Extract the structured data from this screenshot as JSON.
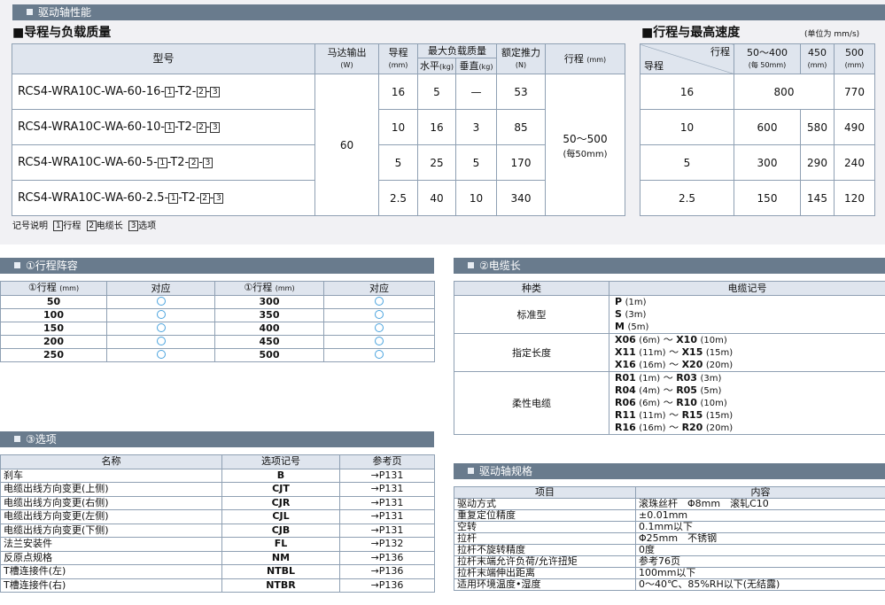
{
  "section_main": {
    "title": "驱动轴性能"
  },
  "lead_load": {
    "heading": "■导程与负载质量",
    "headers": {
      "model": "型号",
      "motor": "马达输出",
      "motor_unit": "(W)",
      "lead": "导程",
      "lead_unit": "(mm)",
      "max_load": "最大负载质量",
      "horizontal": "水平",
      "vertical": "垂直",
      "kg": "(kg)",
      "thrust": "额定推力",
      "thrust_unit": "(N)",
      "stroke": "行程",
      "stroke_unit": "(mm)"
    },
    "motor_value": "60",
    "stroke_value": "50～500",
    "stroke_note": "(每50mm)",
    "rows": [
      {
        "prefix": "RCS4-WRA10C-WA-60-16-",
        "lead": "16",
        "horizontal": "5",
        "vertical": "—",
        "thrust": "53"
      },
      {
        "prefix": "RCS4-WRA10C-WA-60-10-",
        "lead": "10",
        "horizontal": "16",
        "vertical": "3",
        "thrust": "85"
      },
      {
        "prefix": "RCS4-WRA10C-WA-60-5-",
        "lead": "5",
        "horizontal": "25",
        "vertical": "5",
        "thrust": "170"
      },
      {
        "prefix": "RCS4-WRA10C-WA-60-2.5-",
        "lead": "2.5",
        "horizontal": "40",
        "vertical": "10",
        "thrust": "340"
      }
    ],
    "code_boxes": {
      "b1": "1",
      "b2": "2",
      "b3": "3",
      "mid": "-T2-",
      "sep": "-"
    },
    "legend": {
      "label": "记号说明",
      "item1": "行程",
      "item2": "电缆长",
      "item3": "选项"
    }
  },
  "stroke_speed": {
    "heading": "■行程与最高速度",
    "unit_note": "(单位为 mm/s)",
    "corner_top": "行程",
    "corner_bottom": "导程",
    "col1": "50～400",
    "col1_note": "(每 50mm)",
    "col2": "450",
    "col2_unit": "(mm)",
    "col3": "500",
    "col3_unit": "(mm)",
    "rows": [
      {
        "lead": "16",
        "merged": "800",
        "c3": "770"
      },
      {
        "lead": "10",
        "c1": "600",
        "c2": "580",
        "c3": "490"
      },
      {
        "lead": "5",
        "c1": "300",
        "c2": "290",
        "c3": "240"
      },
      {
        "lead": "2.5",
        "c1": "150",
        "c2": "145",
        "c3": "120"
      }
    ]
  },
  "stroke_list": {
    "title": "①行程阵容",
    "h_stroke": "①行程",
    "h_unit": "(mm)",
    "h_support": "对应",
    "rows": [
      {
        "a": "50",
        "b": "300"
      },
      {
        "a": "100",
        "b": "350"
      },
      {
        "a": "150",
        "b": "400"
      },
      {
        "a": "200",
        "b": "450"
      },
      {
        "a": "250",
        "b": "500"
      }
    ]
  },
  "cable": {
    "title": "②电缆长",
    "h_type": "种类",
    "h_code": "电缆记号",
    "groups": [
      {
        "type": "标准型",
        "lines": [
          {
            "code": "P",
            "len": "(1m)"
          },
          {
            "code": "S",
            "len": "(3m)"
          },
          {
            "code": "M",
            "len": "(5m)"
          }
        ]
      },
      {
        "type": "指定长度",
        "lines": [
          {
            "c1": "X06",
            "l1": "(6m)",
            "c2": "X10",
            "l2": "(10m)"
          },
          {
            "c1": "X11",
            "l1": "(11m)",
            "c2": "X15",
            "l2": "(15m)"
          },
          {
            "c1": "X16",
            "l1": "(16m)",
            "c2": "X20",
            "l2": "(20m)"
          }
        ]
      },
      {
        "type": "柔性电缆",
        "lines": [
          {
            "c1": "R01",
            "l1": "(1m)",
            "c2": "R03",
            "l2": "(3m)"
          },
          {
            "c1": "R04",
            "l1": "(4m)",
            "c2": "R05",
            "l2": "(5m)"
          },
          {
            "c1": "R06",
            "l1": "(6m)",
            "c2": "R10",
            "l2": "(10m)"
          },
          {
            "c1": "R11",
            "l1": "(11m)",
            "c2": "R15",
            "l2": "(15m)"
          },
          {
            "c1": "R16",
            "l1": "(16m)",
            "c2": "R20",
            "l2": "(20m)"
          }
        ]
      }
    ],
    "tilde": "～"
  },
  "options": {
    "title": "③选项",
    "h_name": "名称",
    "h_code": "选项记号",
    "h_page": "参考页",
    "rows": [
      {
        "name": "刹车",
        "code": "B",
        "page": "→P131"
      },
      {
        "name": "电缆出线方向变更(上侧)",
        "code": "CJT",
        "page": "→P131"
      },
      {
        "name": "电缆出线方向变更(右侧)",
        "code": "CJR",
        "page": "→P131"
      },
      {
        "name": "电缆出线方向变更(左侧)",
        "code": "CJL",
        "page": "→P131"
      },
      {
        "name": "电缆出线方向变更(下侧)",
        "code": "CJB",
        "page": "→P131"
      },
      {
        "name": "法兰安装件",
        "code": "FL",
        "page": "→P132"
      },
      {
        "name": "反原点规格",
        "code": "NM",
        "page": "→P136"
      },
      {
        "name": "T槽连接件(左)",
        "code": "NTBL",
        "page": "→P136"
      },
      {
        "name": "T槽连接件(右)",
        "code": "NTBR",
        "page": "→P136"
      }
    ]
  },
  "spec": {
    "title": "驱动轴规格",
    "h_item": "项目",
    "h_content": "内容",
    "rows": [
      {
        "item": "驱动方式",
        "content": "滚珠丝杆　Φ8mm　滚轧C10"
      },
      {
        "item": "重复定位精度",
        "content": "±0.01mm"
      },
      {
        "item": "空转",
        "content": "0.1mm以下"
      },
      {
        "item": "拉杆",
        "content": "Φ25mm　不锈钢"
      },
      {
        "item": "拉杆不旋转精度",
        "content": "0度"
      },
      {
        "item": "拉杆末端允许负荷/允许扭矩",
        "content": "参考76页"
      },
      {
        "item": "拉杆末端伸出距离",
        "content": "100mm以下"
      },
      {
        "item": "适用环境温度•湿度",
        "content": "0～40℃、85%RH以下(无结露)"
      }
    ]
  }
}
